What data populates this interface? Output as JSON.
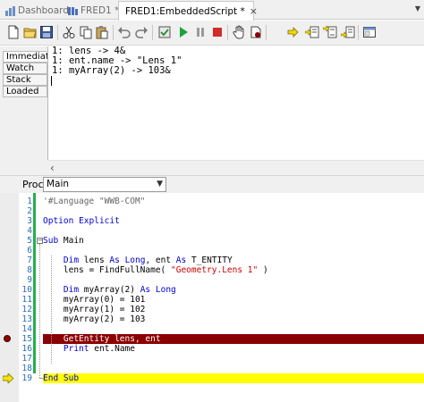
{
  "tabs": [
    {
      "label": "Dashboard",
      "icon": "dashboard-icon",
      "active": false
    },
    {
      "label": "FRED1 *",
      "icon": "fred-icon",
      "active": false
    },
    {
      "label": "FRED1:EmbeddedScript *",
      "icon": "script-icon",
      "active": true
    }
  ],
  "tab_close": "×",
  "toolbar": {
    "buttons": [
      "new-icon",
      "open-icon",
      "save-icon",
      "cut-icon",
      "copy-icon",
      "paste-icon",
      "undo-icon",
      "redo-icon",
      "compile-icon",
      "run-icon",
      "pause-icon",
      "stop-icon",
      "hand-icon",
      "breakpoint-icon",
      "step-into-icon",
      "step-over-icon",
      "step-out-icon",
      "run-to-cursor-icon",
      "watch-icon"
    ]
  },
  "debug": {
    "side_tabs": [
      "Immediate",
      "Watch",
      "Stack",
      "Loaded"
    ],
    "lines": [
      "1: lens -> 4&",
      "1: ent.name -> \"Lens 1\"",
      "1: myArray(2) -> 103&"
    ]
  },
  "proc": {
    "label": "Proc:",
    "value": "Main"
  },
  "code": {
    "lines": [
      {
        "n": "1",
        "text": "'#Language \"WWB-COM\""
      },
      {
        "n": "2",
        "text": ""
      },
      {
        "n": "3",
        "text": "Option Explicit"
      },
      {
        "n": "4",
        "text": ""
      },
      {
        "n": "5",
        "text": "Sub Main"
      },
      {
        "n": "6",
        "text": ""
      },
      {
        "n": "7",
        "text": "    Dim lens As Long, ent As T_ENTITY"
      },
      {
        "n": "8",
        "text": "    lens = FindFullName( \"Geometry.Lens 1\" )"
      },
      {
        "n": "9",
        "text": ""
      },
      {
        "n": "10",
        "text": "    Dim myArray(2) As Long"
      },
      {
        "n": "11",
        "text": "    myArray(0) = 101"
      },
      {
        "n": "12",
        "text": "    myArray(1) = 102"
      },
      {
        "n": "13",
        "text": "    myArray(2) = 103"
      },
      {
        "n": "14",
        "text": ""
      },
      {
        "n": "15",
        "text": "    GetEntity lens, ent"
      },
      {
        "n": "16",
        "text": "    Print ent.Name"
      },
      {
        "n": "17",
        "text": ""
      },
      {
        "n": "18",
        "text": ""
      },
      {
        "n": "19",
        "text": "End Sub"
      }
    ],
    "breakpoint_line": "15",
    "current_line": "19"
  },
  "colors": {
    "breakpoint": "#8b0000",
    "current": "#ffff00",
    "keyword": "#0000cc",
    "string": "#cc0000",
    "linenum": "#2b6db5",
    "changed": "#22b14c"
  }
}
